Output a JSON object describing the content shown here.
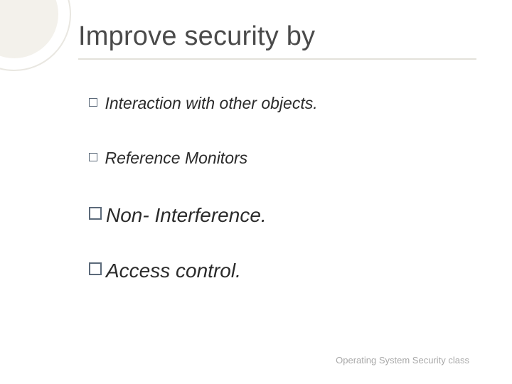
{
  "title": "Improve security by",
  "bullets": [
    {
      "text": " Interaction with other objects.",
      "size": "small"
    },
    {
      "text": " Reference Monitors",
      "size": "small"
    },
    {
      "text": "Non- Interference.",
      "size": "large"
    },
    {
      "text": "Access control.",
      "size": "large"
    }
  ],
  "footer": "Operating System Security class"
}
